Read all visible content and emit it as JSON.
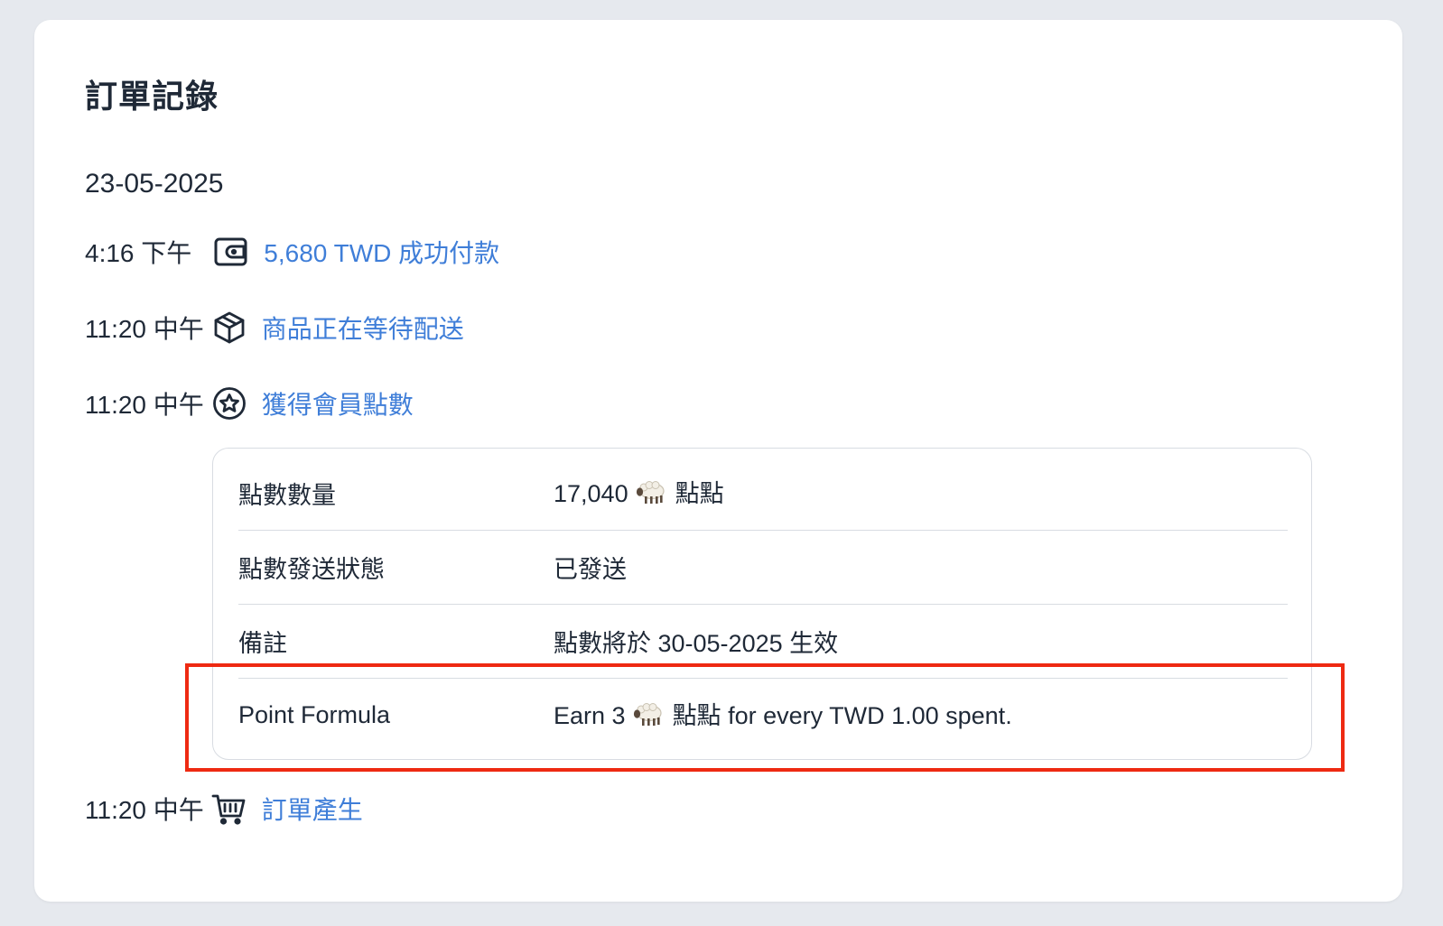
{
  "page": {
    "title": "訂單記錄",
    "date": "23-05-2025"
  },
  "events": [
    {
      "time": "4:16 下午",
      "icon": "wallet-icon",
      "text": "5,680 TWD 成功付款"
    },
    {
      "time": "11:20 中午",
      "icon": "package-icon",
      "text": "商品正在等待配送"
    },
    {
      "time": "11:20 中午",
      "icon": "star-icon",
      "text": "獲得會員點數"
    },
    {
      "time": "11:20 中午",
      "icon": "shopping-cart-icon",
      "text": "訂單產生"
    }
  ],
  "points_details": {
    "rows": [
      {
        "label": "點數數量",
        "value_prefix": "17,040",
        "value_suffix": "點點"
      },
      {
        "label": "點數發送狀態",
        "value": "已發送"
      },
      {
        "label": "備註",
        "value": "點數將於 30-05-2025 生效"
      },
      {
        "label": "Point Formula",
        "value_prefix": "Earn 3",
        "value_suffix": "點點 for every TWD 1.00 spent."
      }
    ]
  },
  "colors": {
    "link": "#3f7ed8",
    "highlight_border": "#ee2a12",
    "background": "#e6e9ee"
  }
}
